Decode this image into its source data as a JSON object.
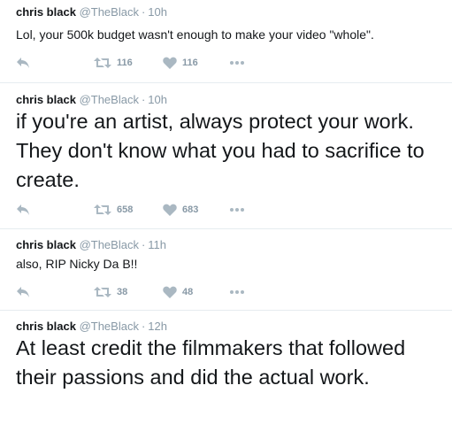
{
  "tweets": [
    {
      "name": "chris black",
      "handle": "@TheBlack",
      "time": "10h",
      "text": "Lol, your 500k budget wasn't enough to make your video \"whole\".",
      "retweets": "116",
      "likes": "116"
    },
    {
      "name": "chris black",
      "handle": "@TheBlack",
      "time": "10h",
      "text": "if you're an artist, always protect your work. They don't know what you had to sacrifice to create.",
      "retweets": "658",
      "likes": "683"
    },
    {
      "name": "chris black",
      "handle": "@TheBlack",
      "time": "11h",
      "text": "also, RIP Nicky Da B!!",
      "retweets": "38",
      "likes": "48"
    },
    {
      "name": "chris black",
      "handle": "@TheBlack",
      "time": "12h",
      "text": "At least credit the filmmakers that followed their passions and did the actual work."
    }
  ],
  "separator": "·",
  "icons": {
    "reply": "reply-icon",
    "retweet": "retweet-icon",
    "like": "heart-icon",
    "more": "more-icon"
  },
  "colors": {
    "name": "#14171a",
    "meta": "#8899a6",
    "icon": "#aab8c2",
    "divider": "#e6ecf0"
  }
}
